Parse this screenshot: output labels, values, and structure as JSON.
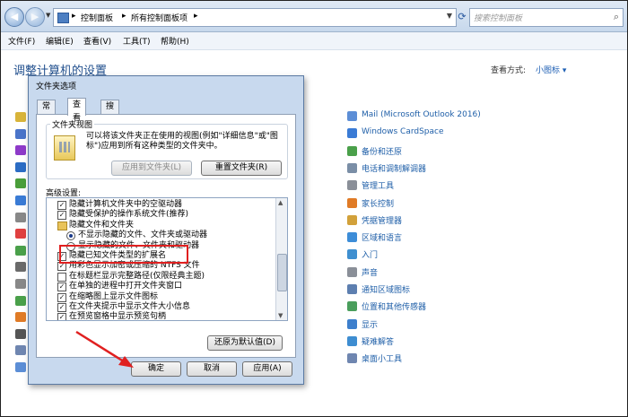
{
  "nav": {
    "breadcrumbs": [
      "控制面板",
      "所有控制面板项"
    ],
    "search_placeholder": "搜索控制面板",
    "back_icon": "back-arrow-icon",
    "forward_icon": "forward-arrow-icon"
  },
  "menu": [
    "文件(F)",
    "编辑(E)",
    "查看(V)",
    "工具(T)",
    "帮助(H)"
  ],
  "control_panel": {
    "title": "调整计算机的设置",
    "view_by_label": "查看方式:",
    "view_by_value": "小图标 ▾",
    "right_items": [
      {
        "label": "Mail (Microsoft Outlook 2016)",
        "color": "#5c8ed6"
      },
      {
        "label": "Windows CardSpace",
        "color": "#3a7bd5"
      },
      {
        "label": "备份和还原",
        "color": "#4aa04a"
      },
      {
        "label": "电话和调制解调器",
        "color": "#7a8ea6"
      },
      {
        "label": "管理工具",
        "color": "#8a8f98"
      },
      {
        "label": "家长控制",
        "color": "#e07b26"
      },
      {
        "label": "凭据管理器",
        "color": "#d2a13a"
      },
      {
        "label": "区域和语言",
        "color": "#3d8dd8"
      },
      {
        "label": "入门",
        "color": "#3f8fd0"
      },
      {
        "label": "声音",
        "color": "#8a8f98"
      },
      {
        "label": "通知区域图标",
        "color": "#5d7fb0"
      },
      {
        "label": "位置和其他传感器",
        "color": "#4a9e5c"
      },
      {
        "label": "显示",
        "color": "#3d7fcc"
      },
      {
        "label": "疑难解答",
        "color": "#3e8dd1"
      },
      {
        "label": "桌面小工具",
        "color": "#6f86b0"
      }
    ],
    "left_icon_colors": [
      "#d8b43a",
      "#4a74c9",
      "#8e3ac9",
      "#2b6cc4",
      "#4a9e3a",
      "#3a7bd5",
      "#888",
      "#e04040",
      "#4aa04a",
      "#6a6a6a",
      "#888",
      "#4aa04a",
      "#e07b26",
      "#555",
      "#6f86b0",
      "#5c8ed6"
    ]
  },
  "dialog": {
    "title": "文件夹选项",
    "tabs": [
      "常规",
      "查看",
      "搜索"
    ],
    "folder_views_title": "文件夹视图",
    "folder_views_text": "可以将该文件夹正在使用的视图(例如\"详细信息\"或\"图标\")应用到所有这种类型的文件夹中。",
    "apply_to_folders": "应用到文件夹(L)",
    "reset_folders": "重置文件夹(R)",
    "advanced_label": "高级设置:",
    "advanced_items": [
      {
        "kind": "check",
        "checked": true,
        "indent": 1,
        "label": "隐藏计算机文件夹中的空驱动器"
      },
      {
        "kind": "check",
        "checked": true,
        "indent": 1,
        "label": "隐藏受保护的操作系统文件(推荐)"
      },
      {
        "kind": "folder",
        "indent": 1,
        "label": "隐藏文件和文件夹"
      },
      {
        "kind": "radio",
        "checked": true,
        "indent": 2,
        "label": "不显示隐藏的文件、文件夹或驱动器"
      },
      {
        "kind": "radio",
        "checked": false,
        "indent": 2,
        "label": "显示隐藏的文件、文件夹和驱动器"
      },
      {
        "kind": "check",
        "checked": true,
        "indent": 1,
        "label": "隐藏已知文件类型的扩展名"
      },
      {
        "kind": "check",
        "checked": true,
        "indent": 1,
        "label": "用彩色显示加密或压缩的 NTFS 文件"
      },
      {
        "kind": "check",
        "checked": false,
        "indent": 1,
        "label": "在标题栏显示完整路径(仅限经典主题)"
      },
      {
        "kind": "check",
        "checked": true,
        "indent": 1,
        "label": "在单独的进程中打开文件夹窗口"
      },
      {
        "kind": "check",
        "checked": true,
        "indent": 1,
        "label": "在缩略图上显示文件图标"
      },
      {
        "kind": "check",
        "checked": true,
        "indent": 1,
        "label": "在文件夹提示中显示文件大小信息"
      },
      {
        "kind": "check",
        "checked": true,
        "indent": 1,
        "label": "在预览窗格中显示预览句柄"
      }
    ],
    "restore_defaults": "还原为默认值(D)",
    "ok": "确定",
    "cancel": "取消",
    "apply": "应用(A)"
  },
  "annotation_color": "#e02020"
}
